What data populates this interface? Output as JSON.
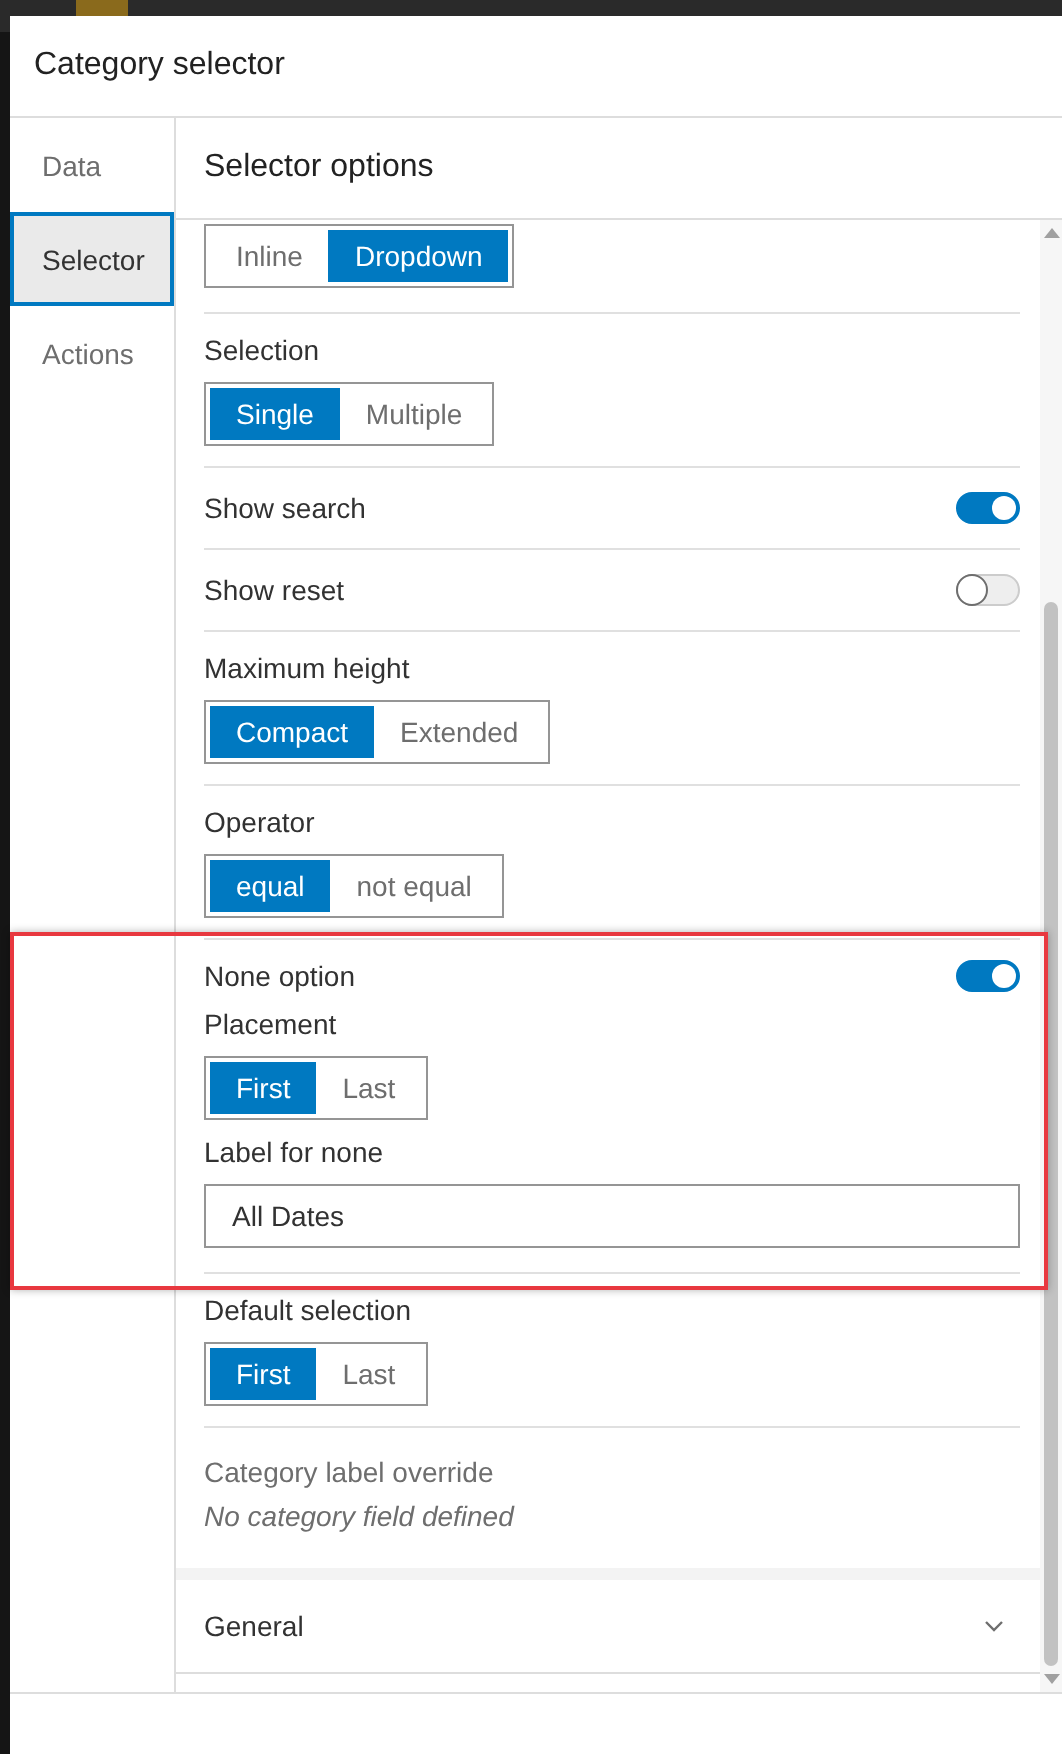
{
  "dialog": {
    "title": "Category selector"
  },
  "nav": [
    {
      "label": "Data",
      "selected": false
    },
    {
      "label": "Selector",
      "selected": true
    },
    {
      "label": "Actions",
      "selected": false
    }
  ],
  "panel": {
    "title": "Selector options"
  },
  "settings": [
    {
      "kind": "segmented",
      "options": [
        {
          "label": "Inline",
          "selected": false
        },
        {
          "label": "Dropdown",
          "selected": true
        }
      ]
    },
    {
      "kind": "segmented",
      "label": "Selection",
      "options": [
        {
          "label": "Single",
          "selected": true
        },
        {
          "label": "Multiple",
          "selected": false
        }
      ]
    },
    {
      "kind": "toggle",
      "label": "Show search",
      "on": true
    },
    {
      "kind": "toggle",
      "label": "Show reset",
      "on": false
    },
    {
      "kind": "segmented",
      "label": "Maximum height",
      "options": [
        {
          "label": "Compact",
          "selected": true
        },
        {
          "label": "Extended",
          "selected": false
        }
      ]
    },
    {
      "kind": "segmented",
      "label": "Operator",
      "options": [
        {
          "label": "equal",
          "selected": true
        },
        {
          "label": "not equal",
          "selected": false
        }
      ]
    },
    {
      "kind": "group",
      "highlighted": true,
      "items": [
        {
          "kind": "toggle",
          "label": "None option",
          "on": true
        },
        {
          "kind": "segmented",
          "label": "Placement",
          "options": [
            {
              "label": "First",
              "selected": true
            },
            {
              "label": "Last",
              "selected": false
            }
          ]
        },
        {
          "kind": "field",
          "label": "Label for none",
          "value": "All Dates"
        }
      ]
    },
    {
      "kind": "segmented",
      "label": "Default selection",
      "options": [
        {
          "label": "First",
          "selected": true
        },
        {
          "label": "Last",
          "selected": false
        }
      ]
    },
    {
      "kind": "note",
      "label": "Category label override",
      "text": "No category field defined"
    }
  ],
  "sections": [
    {
      "label": "General",
      "expanded": false
    }
  ]
}
